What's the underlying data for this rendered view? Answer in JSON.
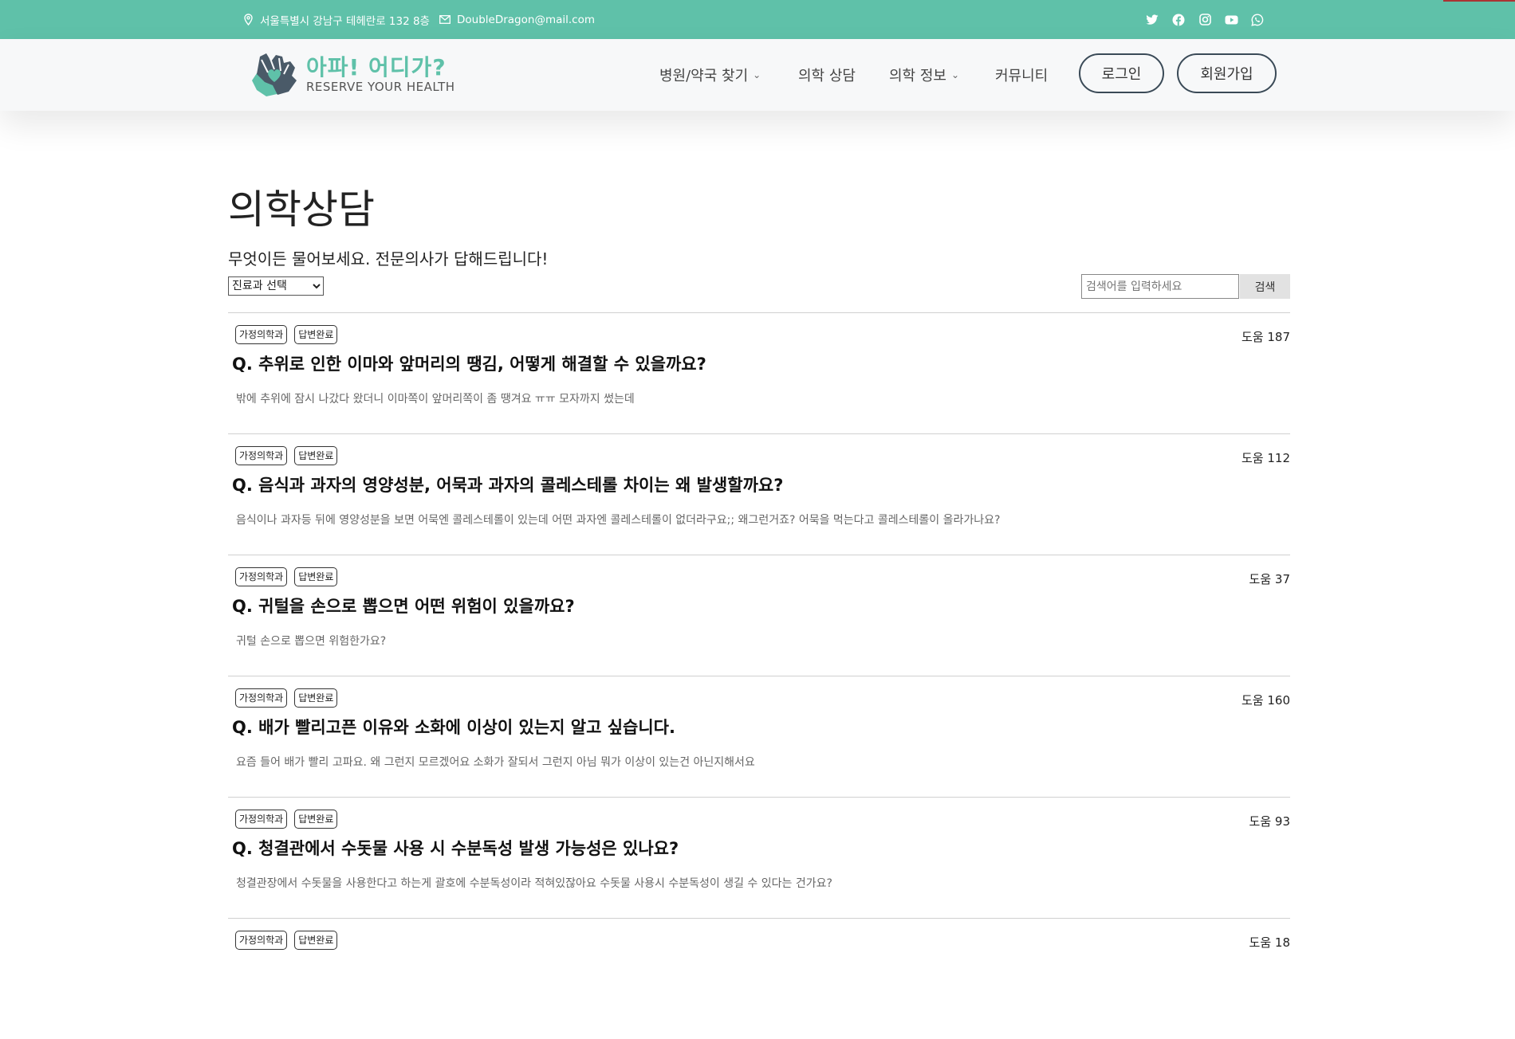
{
  "topbar": {
    "address": "서울특별시 강남구 테헤란로 132 8층",
    "email": "DoubleDragon@mail.com",
    "socials": [
      "twitter-icon",
      "facebook-icon",
      "instagram-icon",
      "youtube-icon",
      "whatsapp-icon"
    ]
  },
  "brand": {
    "title": "아파! 어디가?",
    "subtitle": "RESERVE YOUR HEALTH",
    "accent_color": "#5fc1a9"
  },
  "nav": {
    "items": [
      "병원/약국 찾기",
      "의학 상담",
      "의학 정보",
      "커뮤니티"
    ],
    "login": "로그인",
    "signup": "회원가입"
  },
  "page": {
    "title": "의학상담",
    "subtitle": "무엇이든 물어보세요. 전문의사가 답해드립니다!"
  },
  "filter": {
    "department_selected": "진료과 선택",
    "search_placeholder": "검색어를 입력하세요",
    "search_button": "검색"
  },
  "questions": [
    {
      "dept": "가정의학과",
      "status": "답변완료",
      "help": "도움 187",
      "title": "Q. 추위로 인한 이마와 앞머리의 땡김, 어떻게 해결할 수 있을까요?",
      "body": "밖에 추위에 잠시 나갔다 왔더니 이마쪽이 앞머리쪽이 좀 땡겨요 ㅠㅠ 모자까지 썼는데"
    },
    {
      "dept": "가정의학과",
      "status": "답변완료",
      "help": "도움 112",
      "title": "Q. 음식과 과자의 영양성분, 어묵과 과자의 콜레스테롤 차이는 왜 발생할까요?",
      "body": "음식이나 과자등 뒤에 영양성분을 보면 어묵엔 콜레스테롤이 있는데 어떤 과자엔 콜레스테롤이 없더라구요;; 왜그런거죠? 어묵을 먹는다고 콜레스테롤이 올라가나요?"
    },
    {
      "dept": "가정의학과",
      "status": "답변완료",
      "help": "도움 37",
      "title": "Q. 귀털을 손으로 뽑으면 어떤 위험이 있을까요?",
      "body": "귀털 손으로 뽑으면 위험한가요?"
    },
    {
      "dept": "가정의학과",
      "status": "답변완료",
      "help": "도움 160",
      "title": "Q. 배가 빨리고픈 이유와 소화에 이상이 있는지 알고 싶습니다.",
      "body": "요즘 들어 배가 빨리 고파요. 왜 그런지 모르겠어요 소화가 잘되서 그런지 아님 뭐가 이상이 있는건 아닌지해서요"
    },
    {
      "dept": "가정의학과",
      "status": "답변완료",
      "help": "도움 93",
      "title": "Q. 청결관에서 수돗물 사용 시 수분독성 발생 가능성은 있나요?",
      "body": "청결관장에서 수돗물을 사용한다고 하는게 괄호에 수분독성이라 적혀있잖아요 수돗물 사용시 수분독성이 생길 수 있다는 건가요?"
    },
    {
      "dept": "가정의학과",
      "status": "답변완료",
      "help": "도움 18",
      "title": "",
      "body": ""
    }
  ]
}
